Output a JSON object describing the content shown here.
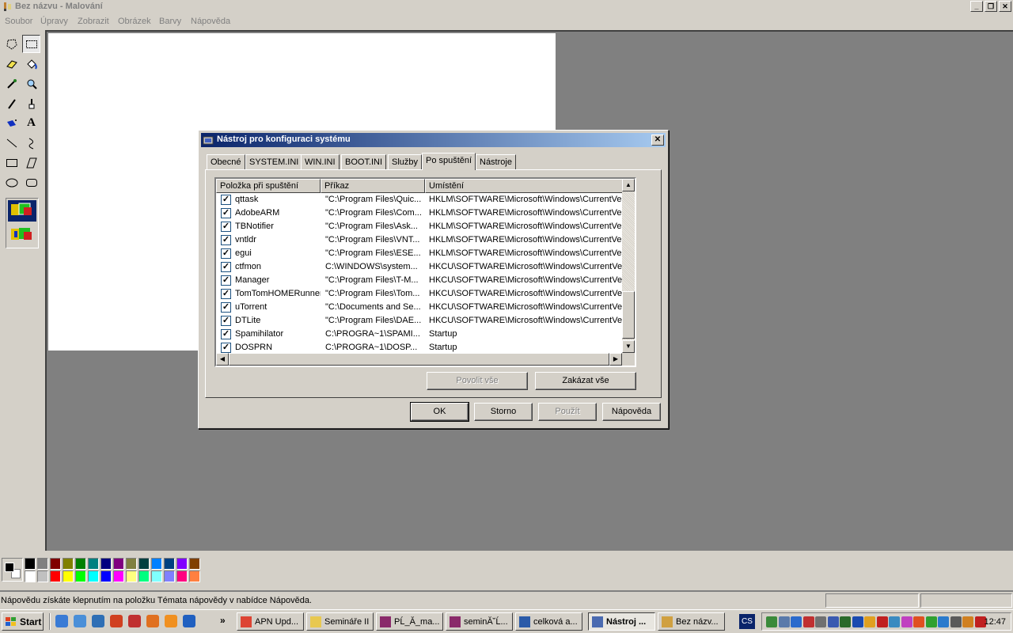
{
  "window": {
    "title": "Bez názvu - Malování"
  },
  "menu": [
    "Soubor",
    "Úpravy",
    "Zobrazit",
    "Obrázek",
    "Barvy",
    "Nápověda"
  ],
  "toolbar": {
    "tools": [
      "free-select",
      "select",
      "eraser",
      "fill",
      "color-picker",
      "magnifier",
      "pencil",
      "brush",
      "airbrush",
      "text",
      "line",
      "curve",
      "rectangle",
      "polygon",
      "ellipse",
      "rounded-rectangle"
    ],
    "text_tool_glyph": "A"
  },
  "palette": {
    "top_row": [
      "#000000",
      "#808080",
      "#800000",
      "#808000",
      "#008000",
      "#008080",
      "#000080",
      "#800080",
      "#808040",
      "#004040",
      "#0080ff",
      "#004080",
      "#8000ff",
      "#804000"
    ],
    "bottom_row": [
      "#ffffff",
      "#c0c0c0",
      "#ff0000",
      "#ffff00",
      "#00ff00",
      "#00ffff",
      "#0000ff",
      "#ff00ff",
      "#ffff80",
      "#00ff80",
      "#80ffff",
      "#8080ff",
      "#ff0080",
      "#ff8040"
    ],
    "foreground": "#000000",
    "background": "#ffffff"
  },
  "status": {
    "message": "Nápovědu získáte klepnutím na položku Témata nápovědy v nabídce Nápověda."
  },
  "dialog": {
    "title": "Nástroj pro konfiguraci systému",
    "tabs": [
      "Obecné",
      "SYSTEM.INI",
      "WIN.INI",
      "BOOT.INI",
      "Služby",
      "Po spuštění",
      "Nástroje"
    ],
    "active_tab": "Po spuštění",
    "columns": [
      "Položka při spuštění",
      "Příkaz",
      "Umístění"
    ],
    "rows": [
      {
        "checked": true,
        "item": "qttask",
        "command": "\"C:\\Program Files\\Quic...",
        "location": "HKLM\\SOFTWARE\\Microsoft\\Windows\\CurrentVer..."
      },
      {
        "checked": true,
        "item": "AdobeARM",
        "command": "\"C:\\Program Files\\Com...",
        "location": "HKLM\\SOFTWARE\\Microsoft\\Windows\\CurrentVer..."
      },
      {
        "checked": true,
        "item": "TBNotifier",
        "command": "\"C:\\Program Files\\Ask...",
        "location": "HKLM\\SOFTWARE\\Microsoft\\Windows\\CurrentVer..."
      },
      {
        "checked": true,
        "item": "vntldr",
        "command": "\"C:\\Program Files\\VNT...",
        "location": "HKLM\\SOFTWARE\\Microsoft\\Windows\\CurrentVer..."
      },
      {
        "checked": true,
        "item": "egui",
        "command": "\"C:\\Program Files\\ESE...",
        "location": "HKLM\\SOFTWARE\\Microsoft\\Windows\\CurrentVer..."
      },
      {
        "checked": true,
        "item": "ctfmon",
        "command": "C:\\WINDOWS\\system...",
        "location": "HKCU\\SOFTWARE\\Microsoft\\Windows\\CurrentVer..."
      },
      {
        "checked": true,
        "item": "Manager",
        "command": "\"C:\\Program Files\\T-M...",
        "location": "HKCU\\SOFTWARE\\Microsoft\\Windows\\CurrentVer..."
      },
      {
        "checked": true,
        "item": "TomTomHOMERunner",
        "command": "\"C:\\Program Files\\Tom...",
        "location": "HKCU\\SOFTWARE\\Microsoft\\Windows\\CurrentVer..."
      },
      {
        "checked": true,
        "item": "uTorrent",
        "command": "\"C:\\Documents and Se...",
        "location": "HKCU\\SOFTWARE\\Microsoft\\Windows\\CurrentVer..."
      },
      {
        "checked": true,
        "item": "DTLite",
        "command": "\"C:\\Program Files\\DAE...",
        "location": "HKCU\\SOFTWARE\\Microsoft\\Windows\\CurrentVer..."
      },
      {
        "checked": true,
        "item": "Spamihilator",
        "command": "C:\\PROGRA~1\\SPAMI...",
        "location": "Startup"
      },
      {
        "checked": true,
        "item": "DOSPRN",
        "command": "C:\\PROGRA~1\\DOSP...",
        "location": "Startup"
      }
    ],
    "buttons": {
      "enable_all": "Povolit vše",
      "disable_all": "Zakázat vše",
      "ok": "OK",
      "cancel": "Storno",
      "apply": "Použít",
      "help": "Nápověda"
    },
    "close_glyph": "✕"
  },
  "taskbar": {
    "start": "Start",
    "more_glyph": "»",
    "quick_launch_colors": [
      "#3a7bd5",
      "#4a8fd8",
      "#2f6fb5",
      "#d04020",
      "#c03030",
      "#e07020",
      "#f09020",
      "#2060c0"
    ],
    "buttons": [
      {
        "label": "APN Upd...",
        "icon": "chrome-icon",
        "color": "#dd4433",
        "active": false
      },
      {
        "label": "Semináře II",
        "icon": "folder-icon",
        "color": "#e8c850",
        "active": false
      },
      {
        "label": "PĹ_Ă_ma...",
        "icon": "winrar-icon",
        "color": "#8a2a6a",
        "active": false
      },
      {
        "label": "seminĂ˘Ĺ...",
        "icon": "winrar-icon",
        "color": "#8a2a6a",
        "active": false
      },
      {
        "label": "celková a...",
        "icon": "word-icon",
        "color": "#2a5aa8",
        "active": false
      },
      {
        "label": "Nástroj ...",
        "icon": "msconfig-icon",
        "color": "#4a6ab0",
        "active": true
      },
      {
        "label": "Bez názv...",
        "icon": "paint-icon",
        "color": "#d0a040",
        "active": false
      }
    ],
    "language": "CS",
    "tray_colors": [
      "#3a8a3a",
      "#5a7aaa",
      "#2a6acc",
      "#c03030",
      "#707070",
      "#3a5ab0",
      "#2a6a2a",
      "#1a4ab0",
      "#e0a020",
      "#c02020",
      "#3a8ac0",
      "#c040c0",
      "#e05020",
      "#30a030",
      "#2a7acc",
      "#5a5a5a",
      "#d08020",
      "#c02020"
    ],
    "clock": "12:47"
  }
}
